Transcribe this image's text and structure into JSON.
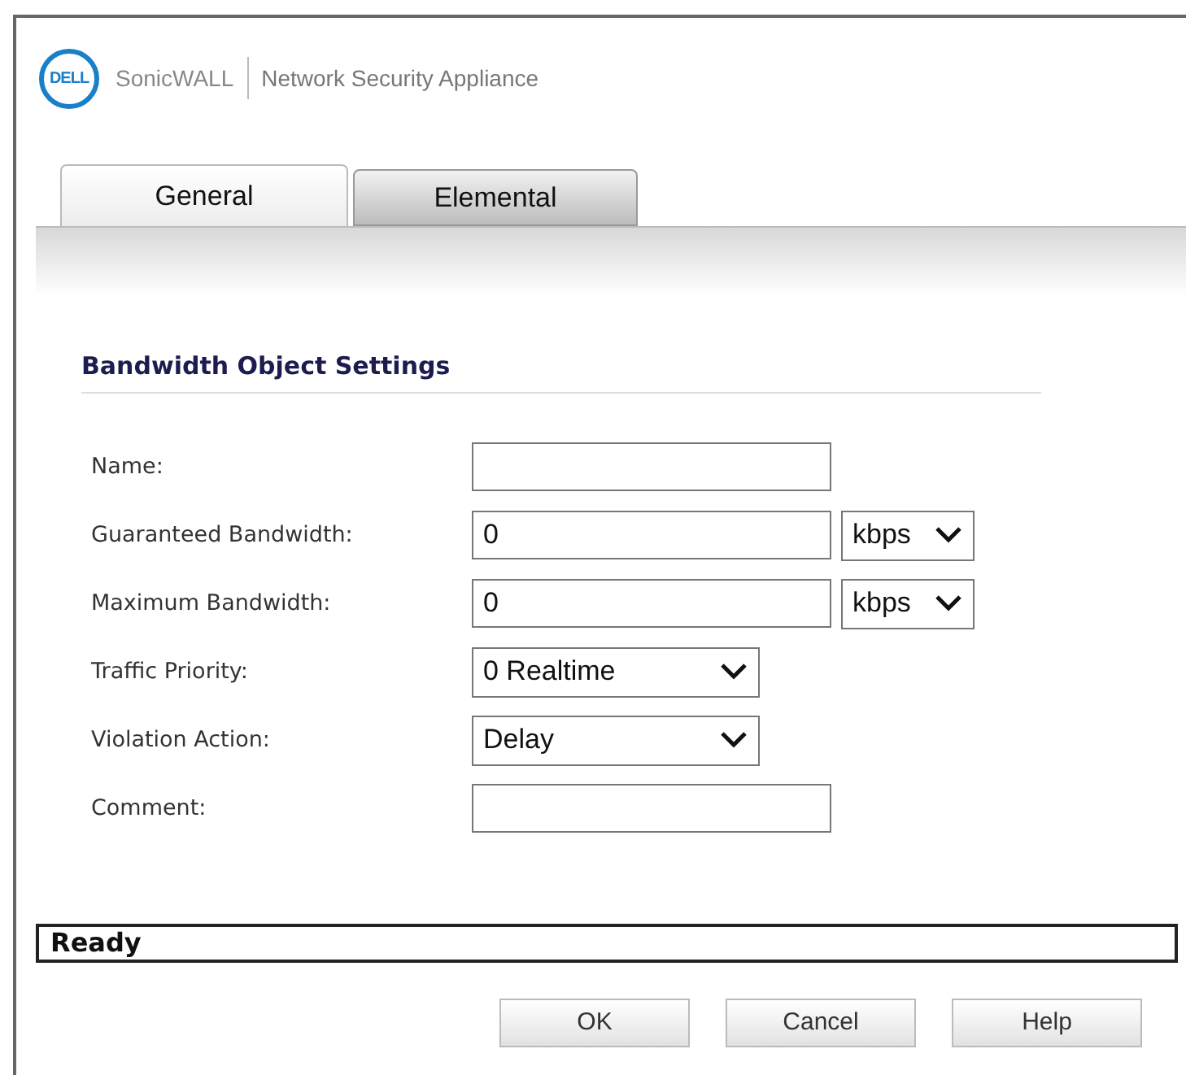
{
  "header": {
    "logo": "DELL",
    "brand": "SonicWALL",
    "product": "Network Security Appliance"
  },
  "tabs": [
    {
      "label": "General",
      "selected": true
    },
    {
      "label": "Elemental",
      "selected": false
    }
  ],
  "section_title": "Bandwidth Object Settings",
  "fields": [
    {
      "label": "Name:",
      "kind": "text"
    },
    {
      "label": "Guaranteed Bandwidth:",
      "kind": "text_unit",
      "value": "0",
      "unit": "kbps"
    },
    {
      "label": "Maximum Bandwidth:",
      "kind": "text_unit",
      "value": "0",
      "unit": "kbps"
    },
    {
      "label": "Traffic Priority:",
      "kind": "select",
      "value": "0 Realtime"
    },
    {
      "label": "Violation Action:",
      "kind": "select",
      "value": "Delay"
    },
    {
      "label": "Comment:",
      "kind": "text"
    }
  ],
  "status_bar": "Ready",
  "buttons": [
    "OK",
    "Cancel",
    "Help"
  ]
}
